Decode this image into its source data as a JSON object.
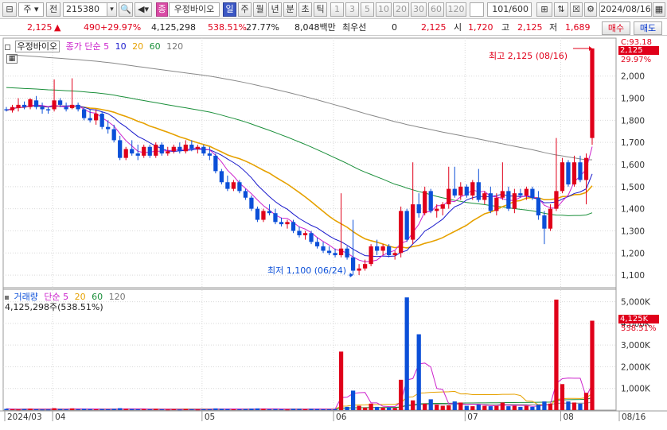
{
  "toolbar": {
    "type_select": "주",
    "prefix": "전",
    "code": "215380",
    "badge": "종",
    "name": "우정바이오",
    "periods": [
      "일",
      "주",
      "월",
      "년",
      "분",
      "초",
      "틱"
    ],
    "active_period": "일",
    "intervals": [
      "1",
      "3",
      "5",
      "10",
      "20",
      "30",
      "60",
      "120"
    ],
    "count": "101/600",
    "date": "2024/08/16"
  },
  "quote": {
    "price": "2,125",
    "change": "490",
    "change_pct": "+29.97%",
    "volume": "4,125,298",
    "volume_ratio": "538.51%",
    "turnover": "27.77%",
    "amount": "8,048백만",
    "min_line_label": "최우선",
    "min_line_value": "0",
    "ask_price": "2,125",
    "open_label": "시",
    "open": "1,720",
    "high_label": "고",
    "high": "2,125",
    "low_label": "저",
    "low": "1,689",
    "buy_label": "매수",
    "sell_label": "매도"
  },
  "price_panel": {
    "legend_name": "우정바이오",
    "legend_series": "종가 단순",
    "ma_periods": [
      "5",
      "10",
      "20",
      "60",
      "120"
    ],
    "ma_colors": [
      "#1a1acc",
      "#cc22cc",
      "#e6a100",
      "#1a8f3a",
      "#888888"
    ],
    "annotation_high": "최고 2,125 (08/16)",
    "annotation_low": "최저 1,100 (06/24)",
    "y_ticks": [
      "2,000",
      "1,900",
      "1,800",
      "1,700",
      "1,600",
      "1,500",
      "1,400",
      "1,300",
      "1,200",
      "1,100"
    ],
    "price_tag": "2,125",
    "price_tag_pct": "29.97%",
    "top_label": "C:93.18"
  },
  "volume_panel": {
    "legend_name": "거래량",
    "legend_series": "단순",
    "ma_periods": [
      "5",
      "20",
      "60",
      "120"
    ],
    "ma_colors": [
      "#1a1acc",
      "#e6a100",
      "#1a8f3a",
      "#888888"
    ],
    "value_text": "4,125,298주(538.51%)",
    "y_ticks": [
      "5,000K",
      "4,000K",
      "3,000K",
      "2,000K",
      "1,000K"
    ],
    "vol_tag": "4,125K",
    "vol_tag_pct": "538.51%"
  },
  "x_axis": {
    "labels": [
      "2024/03",
      "04",
      "05",
      "06",
      "07",
      "08",
      "08/16"
    ]
  },
  "colors": {
    "up": "#e0001a",
    "down": "#0b4fd8",
    "grid": "#d9d9d9"
  },
  "chart_data": {
    "type": "candlestick",
    "y_range": [
      1050,
      2150
    ],
    "volume_range_k": [
      0,
      5500
    ],
    "dates_axis": [
      "2024/03",
      "04",
      "05",
      "06",
      "07",
      "08",
      "08/16"
    ],
    "annotations": [
      {
        "label": "최고",
        "value": 2125,
        "date": "08/16"
      },
      {
        "label": "최저",
        "value": 1100,
        "date": "06/24"
      }
    ],
    "candles": [
      {
        "o": 1850,
        "h": 1860,
        "l": 1840,
        "c": 1845
      },
      {
        "o": 1845,
        "h": 1870,
        "l": 1835,
        "c": 1860
      },
      {
        "o": 1855,
        "h": 1900,
        "l": 1840,
        "c": 1870
      },
      {
        "o": 1870,
        "h": 1885,
        "l": 1850,
        "c": 1860
      },
      {
        "o": 1860,
        "h": 1900,
        "l": 1850,
        "c": 1895
      },
      {
        "o": 1890,
        "h": 1910,
        "l": 1850,
        "c": 1860
      },
      {
        "o": 1860,
        "h": 1880,
        "l": 1830,
        "c": 1850
      },
      {
        "o": 1850,
        "h": 1860,
        "l": 1830,
        "c": 1845
      },
      {
        "o": 1850,
        "h": 1985,
        "l": 1840,
        "c": 1890
      },
      {
        "o": 1890,
        "h": 1900,
        "l": 1860,
        "c": 1870
      },
      {
        "o": 1860,
        "h": 1880,
        "l": 1840,
        "c": 1850
      },
      {
        "o": 1855,
        "h": 1990,
        "l": 1850,
        "c": 1870
      },
      {
        "o": 1870,
        "h": 1880,
        "l": 1840,
        "c": 1850
      },
      {
        "o": 1850,
        "h": 1860,
        "l": 1800,
        "c": 1810
      },
      {
        "o": 1810,
        "h": 1850,
        "l": 1790,
        "c": 1800
      },
      {
        "o": 1800,
        "h": 1850,
        "l": 1780,
        "c": 1830
      },
      {
        "o": 1830,
        "h": 1840,
        "l": 1760,
        "c": 1770
      },
      {
        "o": 1770,
        "h": 1800,
        "l": 1740,
        "c": 1760
      },
      {
        "o": 1760,
        "h": 1780,
        "l": 1700,
        "c": 1710
      },
      {
        "o": 1710,
        "h": 1730,
        "l": 1620,
        "c": 1630
      },
      {
        "o": 1630,
        "h": 1680,
        "l": 1620,
        "c": 1670
      },
      {
        "o": 1670,
        "h": 1710,
        "l": 1640,
        "c": 1650
      },
      {
        "o": 1650,
        "h": 1690,
        "l": 1620,
        "c": 1640
      },
      {
        "o": 1640,
        "h": 1690,
        "l": 1630,
        "c": 1680
      },
      {
        "o": 1680,
        "h": 1690,
        "l": 1630,
        "c": 1640
      },
      {
        "o": 1640,
        "h": 1700,
        "l": 1630,
        "c": 1690
      },
      {
        "o": 1690,
        "h": 1700,
        "l": 1640,
        "c": 1650
      },
      {
        "o": 1650,
        "h": 1680,
        "l": 1640,
        "c": 1660
      },
      {
        "o": 1660,
        "h": 1690,
        "l": 1650,
        "c": 1680
      },
      {
        "o": 1680,
        "h": 1700,
        "l": 1650,
        "c": 1660
      },
      {
        "o": 1660,
        "h": 1710,
        "l": 1650,
        "c": 1690
      },
      {
        "o": 1690,
        "h": 1710,
        "l": 1660,
        "c": 1670
      },
      {
        "o": 1670,
        "h": 1690,
        "l": 1650,
        "c": 1680
      },
      {
        "o": 1680,
        "h": 1690,
        "l": 1640,
        "c": 1650
      },
      {
        "o": 1650,
        "h": 1680,
        "l": 1620,
        "c": 1640
      },
      {
        "o": 1640,
        "h": 1650,
        "l": 1560,
        "c": 1570
      },
      {
        "o": 1570,
        "h": 1580,
        "l": 1510,
        "c": 1520
      },
      {
        "o": 1520,
        "h": 1550,
        "l": 1480,
        "c": 1490
      },
      {
        "o": 1490,
        "h": 1530,
        "l": 1480,
        "c": 1520
      },
      {
        "o": 1520,
        "h": 1530,
        "l": 1470,
        "c": 1480
      },
      {
        "o": 1480,
        "h": 1490,
        "l": 1440,
        "c": 1450
      },
      {
        "o": 1450,
        "h": 1460,
        "l": 1390,
        "c": 1400
      },
      {
        "o": 1400,
        "h": 1410,
        "l": 1340,
        "c": 1350
      },
      {
        "o": 1350,
        "h": 1400,
        "l": 1340,
        "c": 1390
      },
      {
        "o": 1390,
        "h": 1420,
        "l": 1370,
        "c": 1380
      },
      {
        "o": 1380,
        "h": 1400,
        "l": 1330,
        "c": 1340
      },
      {
        "o": 1340,
        "h": 1360,
        "l": 1320,
        "c": 1330
      },
      {
        "o": 1330,
        "h": 1350,
        "l": 1310,
        "c": 1340
      },
      {
        "o": 1340,
        "h": 1350,
        "l": 1290,
        "c": 1300
      },
      {
        "o": 1300,
        "h": 1320,
        "l": 1270,
        "c": 1280
      },
      {
        "o": 1280,
        "h": 1300,
        "l": 1260,
        "c": 1290
      },
      {
        "o": 1290,
        "h": 1300,
        "l": 1240,
        "c": 1250
      },
      {
        "o": 1250,
        "h": 1270,
        "l": 1220,
        "c": 1230
      },
      {
        "o": 1230,
        "h": 1250,
        "l": 1200,
        "c": 1210
      },
      {
        "o": 1210,
        "h": 1230,
        "l": 1190,
        "c": 1200
      },
      {
        "o": 1200,
        "h": 1220,
        "l": 1180,
        "c": 1190
      },
      {
        "o": 1190,
        "h": 1470,
        "l": 1180,
        "c": 1220
      },
      {
        "o": 1220,
        "h": 1230,
        "l": 1170,
        "c": 1180
      },
      {
        "o": 1180,
        "h": 1350,
        "l": 1100,
        "c": 1120
      },
      {
        "o": 1120,
        "h": 1150,
        "l": 1100,
        "c": 1130
      },
      {
        "o": 1130,
        "h": 1170,
        "l": 1120,
        "c": 1150
      },
      {
        "o": 1150,
        "h": 1240,
        "l": 1140,
        "c": 1230
      },
      {
        "o": 1230,
        "h": 1260,
        "l": 1190,
        "c": 1210
      },
      {
        "o": 1210,
        "h": 1240,
        "l": 1190,
        "c": 1230
      },
      {
        "o": 1230,
        "h": 1240,
        "l": 1180,
        "c": 1190
      },
      {
        "o": 1190,
        "h": 1210,
        "l": 1170,
        "c": 1200
      },
      {
        "o": 1200,
        "h": 1410,
        "l": 1180,
        "c": 1390
      },
      {
        "o": 1390,
        "h": 1400,
        "l": 1250,
        "c": 1260
      },
      {
        "o": 1260,
        "h": 1610,
        "l": 1240,
        "c": 1420
      },
      {
        "o": 1420,
        "h": 1470,
        "l": 1360,
        "c": 1380
      },
      {
        "o": 1380,
        "h": 1500,
        "l": 1370,
        "c": 1480
      },
      {
        "o": 1480,
        "h": 1490,
        "l": 1380,
        "c": 1390
      },
      {
        "o": 1390,
        "h": 1420,
        "l": 1360,
        "c": 1400
      },
      {
        "o": 1400,
        "h": 1430,
        "l": 1370,
        "c": 1420
      },
      {
        "o": 1420,
        "h": 1590,
        "l": 1400,
        "c": 1490
      },
      {
        "o": 1490,
        "h": 1590,
        "l": 1450,
        "c": 1460
      },
      {
        "o": 1460,
        "h": 1520,
        "l": 1440,
        "c": 1500
      },
      {
        "o": 1500,
        "h": 1510,
        "l": 1450,
        "c": 1460
      },
      {
        "o": 1460,
        "h": 1530,
        "l": 1440,
        "c": 1520
      },
      {
        "o": 1520,
        "h": 1580,
        "l": 1430,
        "c": 1440
      },
      {
        "o": 1440,
        "h": 1480,
        "l": 1420,
        "c": 1470
      },
      {
        "o": 1470,
        "h": 1500,
        "l": 1380,
        "c": 1390
      },
      {
        "o": 1390,
        "h": 1470,
        "l": 1370,
        "c": 1450
      },
      {
        "o": 1450,
        "h": 1610,
        "l": 1440,
        "c": 1480
      },
      {
        "o": 1480,
        "h": 1500,
        "l": 1390,
        "c": 1400
      },
      {
        "o": 1400,
        "h": 1490,
        "l": 1380,
        "c": 1470
      },
      {
        "o": 1470,
        "h": 1490,
        "l": 1450,
        "c": 1460
      },
      {
        "o": 1460,
        "h": 1500,
        "l": 1440,
        "c": 1490
      },
      {
        "o": 1490,
        "h": 1500,
        "l": 1440,
        "c": 1450
      },
      {
        "o": 1450,
        "h": 1480,
        "l": 1350,
        "c": 1370
      },
      {
        "o": 1370,
        "h": 1390,
        "l": 1240,
        "c": 1310
      },
      {
        "o": 1310,
        "h": 1420,
        "l": 1300,
        "c": 1400
      },
      {
        "o": 1400,
        "h": 1720,
        "l": 1390,
        "c": 1480
      },
      {
        "o": 1480,
        "h": 1630,
        "l": 1470,
        "c": 1610
      },
      {
        "o": 1610,
        "h": 1620,
        "l": 1500,
        "c": 1510
      },
      {
        "o": 1510,
        "h": 1640,
        "l": 1500,
        "c": 1610
      },
      {
        "o": 1610,
        "h": 1640,
        "l": 1520,
        "c": 1530
      },
      {
        "o": 1530,
        "h": 1650,
        "l": 1420,
        "c": 1630
      },
      {
        "o": 1720,
        "h": 2125,
        "l": 1689,
        "c": 2125
      }
    ],
    "volume_k": [
      60,
      40,
      30,
      50,
      70,
      40,
      30,
      30,
      90,
      50,
      40,
      80,
      40,
      60,
      50,
      40,
      50,
      40,
      60,
      90,
      60,
      50,
      40,
      50,
      40,
      60,
      40,
      30,
      40,
      30,
      50,
      40,
      30,
      40,
      40,
      80,
      60,
      50,
      40,
      40,
      50,
      70,
      80,
      60,
      40,
      50,
      40,
      30,
      60,
      60,
      40,
      60,
      50,
      40,
      40,
      50,
      2700,
      150,
      900,
      200,
      120,
      300,
      150,
      120,
      130,
      100,
      1400,
      5200,
      450,
      3500,
      300,
      500,
      250,
      200,
      220,
      400,
      350,
      200,
      180,
      250,
      200,
      180,
      200,
      350,
      180,
      200,
      150,
      200,
      150,
      250,
      400,
      300,
      5100,
      1200,
      400,
      350,
      300,
      800,
      4125
    ]
  }
}
